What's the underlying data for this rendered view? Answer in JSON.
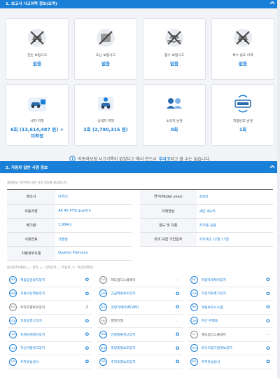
{
  "section1": {
    "title": "1. 보고서 사고이력 정보(요약)",
    "cards_row1": [
      {
        "icon": "car-crossed-icon",
        "label": "전손 보험사고",
        "value": "없음"
      },
      {
        "icon": "car-theft-icon",
        "label": "도난 보험사고",
        "value": "없음"
      },
      {
        "icon": "car-flood-icon",
        "label": "침수 보험사고",
        "value": "없음"
      },
      {
        "icon": "car-special-icon",
        "label": "특수 용도 이력",
        "value": "없음"
      }
    ],
    "cards_row2": [
      {
        "icon": "car-damage-icon",
        "label": "내차 피해",
        "value": "6회 (13,614,487 원) +",
        "value2": "미확정"
      },
      {
        "icon": "car-other-damage-icon",
        "label": "상대차 피해",
        "value": "2회 (2,790,315 원)",
        "value2": ""
      },
      {
        "icon": "owner-change-icon",
        "label": "소유자 변경",
        "value": "0회",
        "value2": ""
      },
      {
        "icon": "plate-change-icon",
        "label": "차량번호 변경",
        "value": "1회",
        "value2": ""
      }
    ],
    "note_pre": "자동차보험 사고기록이 없었다고 해서 반드시",
    "note_bold": "무사고",
    "note_post": "라고 볼 수는 없습니다."
  },
  "section2": {
    "title": "2. 자동차 일반 사양 정보",
    "subtitle": "제원정보 연관하여 일반 사양 정보를 제공합니다.",
    "spec": {
      "rows": [
        {
          "k1": "제조사",
          "v1": "아우디",
          "k2": "연식(Model year)",
          "v2": "2020"
        },
        {
          "k1": "자동차명",
          "v1": "A6 45 TFSI quattro",
          "k2": "차체형상",
          "v2": "세단 4도어"
        },
        {
          "k1": "배기량",
          "v1": "1,984cc",
          "k2": "용도 및 차종",
          "v2": "자가용  승용"
        },
        {
          "k1": "사용연료",
          "v1": "가솔린",
          "k2": "최초 보험 가입일자",
          "v2": "2019년 12월 17일"
        }
      ],
      "detail_label": "차량세부모델",
      "detail_value": "Quattro Premium"
    },
    "legend": "옵션장착(제원) ○ : 장착, △ : 선택장착, - : 미옵션, X : 미장착(확인)",
    "options": [
      {
        "icon": "ABS",
        "name": "제동잠김방지장치",
        "value": "O",
        "active": true
      },
      {
        "icon": "HUD",
        "name": "헤드업디스플레이",
        "value": "-",
        "active": false
      },
      {
        "icon": "ESC",
        "name": "차량자세제어장치",
        "value": "O",
        "active": true
      },
      {
        "icon": "TPMS",
        "name": "자동비상제동장치",
        "value": "O",
        "active": true
      },
      {
        "icon": "AEB",
        "name": "긴급제동보조장치",
        "value": "O",
        "active": true
      },
      {
        "icon": "LDW",
        "name": "차선이탈경고장치",
        "value": "O",
        "active": true
      },
      {
        "icon": "BSD",
        "name": "주차조향보조장치",
        "value": "X",
        "active": false
      },
      {
        "icon": "ACC",
        "name": "후방카메라(BCAM)",
        "value": "O",
        "active": true
      },
      {
        "icon": "SPK",
        "name": "제동보조시스템",
        "value": "O",
        "active": true
      },
      {
        "icon": "FCW",
        "name": "후측방경고장치",
        "value": "O",
        "active": true
      },
      {
        "icon": "HBA",
        "name": "헬멧인형",
        "value": "-",
        "active": false
      },
      {
        "icon": "CAM",
        "name": "주간 주행등",
        "value": "O",
        "active": true
      },
      {
        "icon": "LKA",
        "name": "차체자세제어장치",
        "value": "O",
        "active": true
      },
      {
        "icon": "PDW",
        "name": "전방충돌경고장치",
        "value": "O",
        "active": true
      },
      {
        "icon": "HL",
        "name": "헤드업디스플레이",
        "value": "-",
        "active": false
      },
      {
        "icon": "LCA",
        "name": "차선이탈경고장치",
        "value": "O",
        "active": true
      },
      {
        "icon": "RCW",
        "name": "후방충돌보조장치",
        "value": "O",
        "active": true
      },
      {
        "icon": "TPM",
        "name": "타이어공기압경보장치",
        "value": "O",
        "active": true
      },
      {
        "icon": "SPA",
        "name": "주차유방센서",
        "value": "O",
        "active": true
      },
      {
        "icon": "PAS",
        "name": "주차조향보조장치",
        "value": "O",
        "active": true
      },
      {
        "icon": "RPA",
        "name": "주차유방센서",
        "value": "O",
        "active": true
      }
    ]
  },
  "colors": {
    "accent": "#1a7fd6",
    "header": "#1a7fd6"
  }
}
